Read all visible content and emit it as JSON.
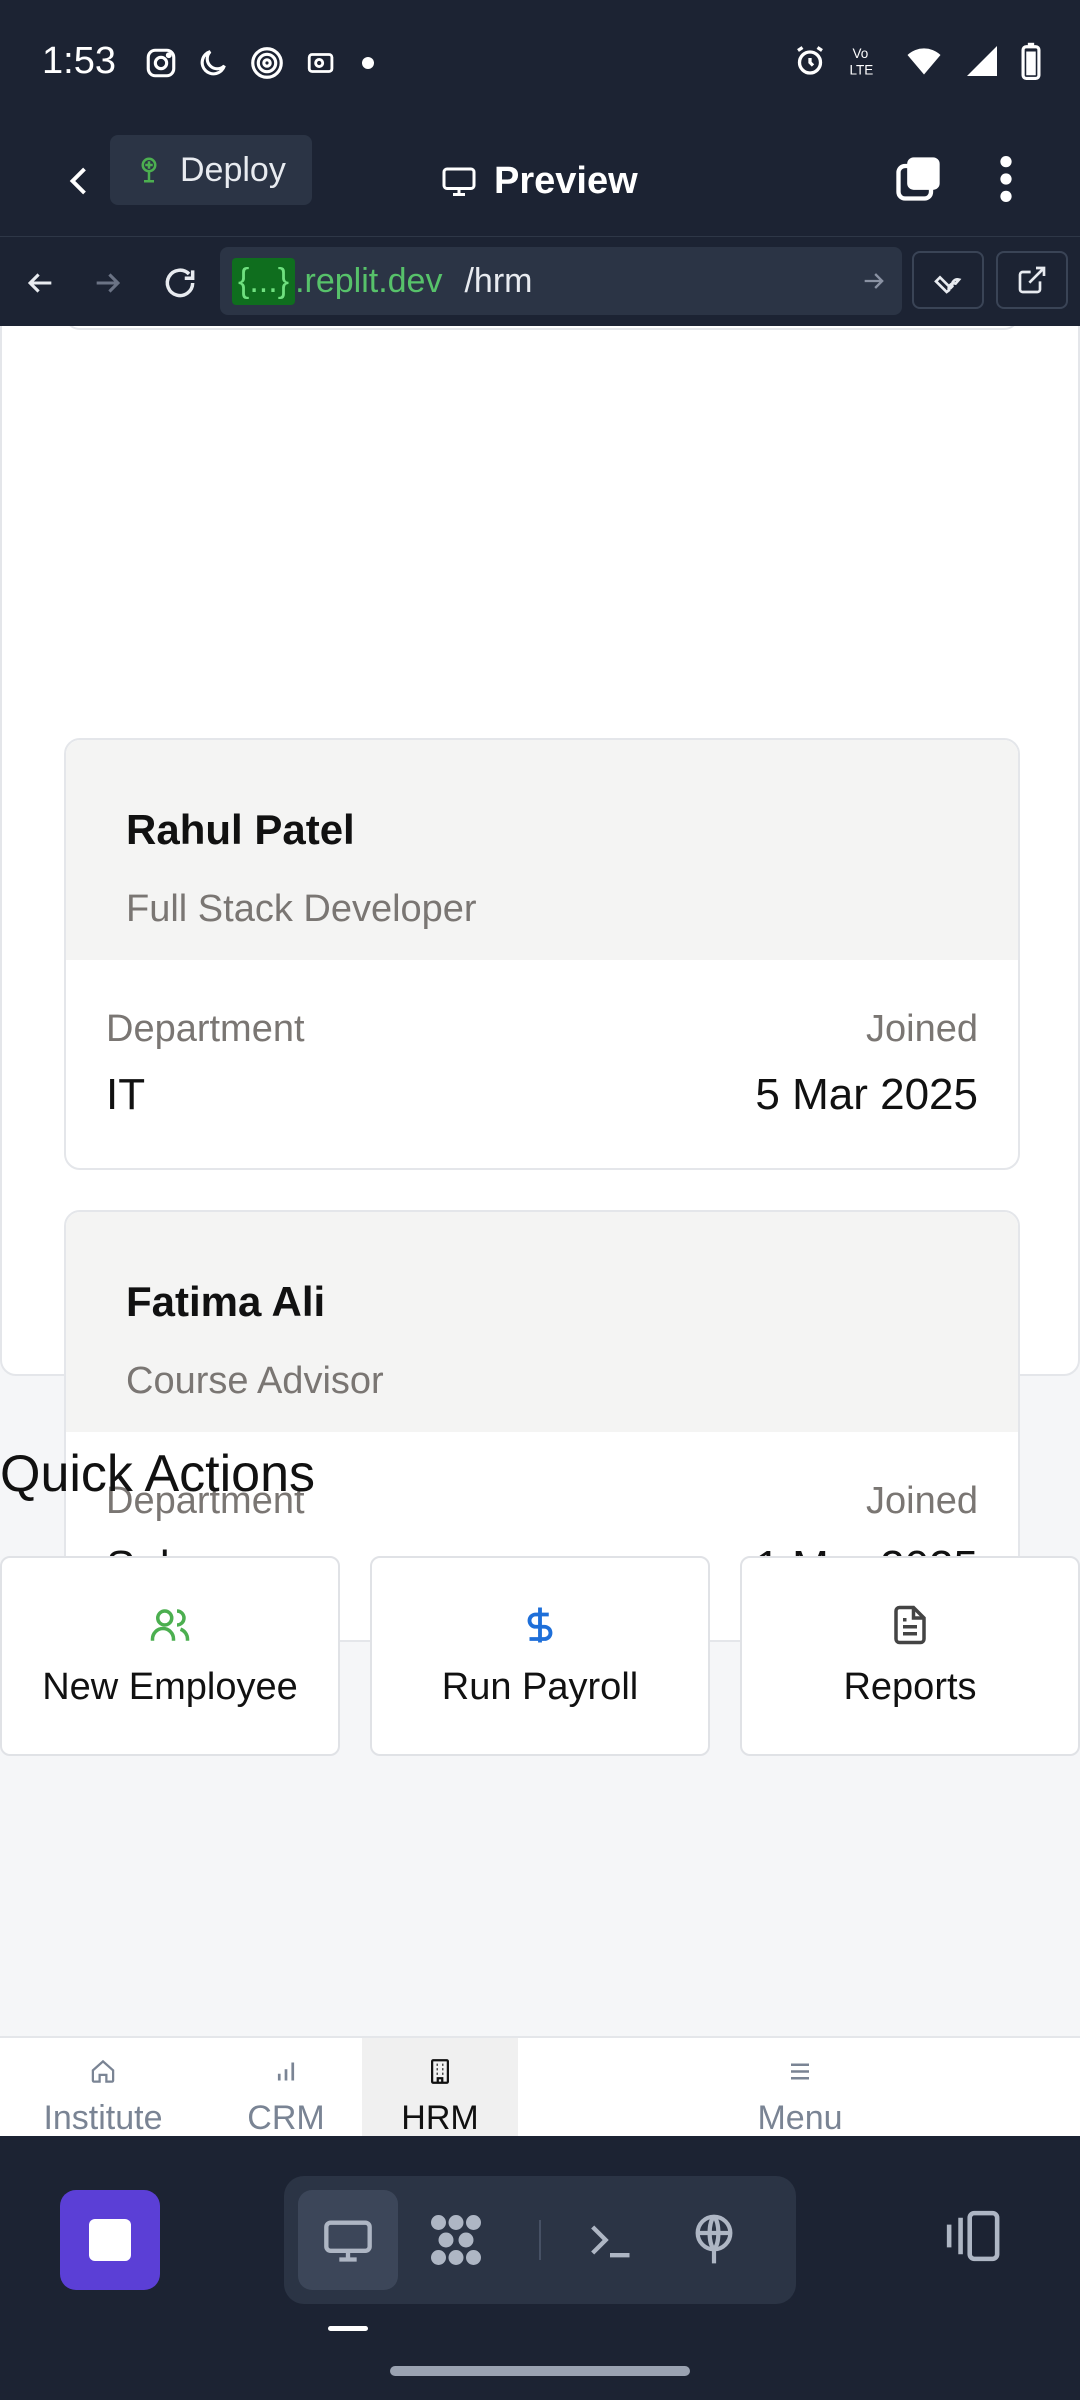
{
  "status_bar": {
    "time": "1:53",
    "left_icons": [
      "instagram-icon",
      "moon-icon",
      "signal-app-icon",
      "ticket-icon",
      "dot-icon"
    ],
    "right_icons": [
      "alarm-icon",
      "volte-icon",
      "wifi-icon",
      "cell-signal-icon",
      "battery-icon"
    ],
    "volte_text": "Vo\nLTE"
  },
  "app_bar": {
    "deploy_label": "Deploy",
    "title": "Preview"
  },
  "url_bar": {
    "host_template": "{...}",
    "host_suffix": ".replit.dev",
    "path": "/hrm"
  },
  "employees": [
    {
      "name": "Rahul Patel",
      "role": "Full Stack Developer",
      "department_label": "Department",
      "department": "IT",
      "joined_label": "Joined",
      "joined": "5 Mar 2025"
    },
    {
      "name": "Fatima Ali",
      "role": "Course Advisor",
      "department_label": "Department",
      "department": "Sales",
      "joined_label": "Joined",
      "joined": "1 Mar 2025"
    }
  ],
  "quick_actions": {
    "title": "Quick Actions",
    "items": [
      {
        "label": "New Employee",
        "icon": "users-icon",
        "color": "#4caf50"
      },
      {
        "label": "Run Payroll",
        "icon": "dollar-icon",
        "color": "#1e6fd9"
      },
      {
        "label": "Reports",
        "icon": "document-icon",
        "color": "#555555"
      }
    ]
  },
  "bottom_tabs": {
    "items": [
      {
        "label": "Institute",
        "icon": "home-icon"
      },
      {
        "label": "CRM",
        "icon": "bar-chart-icon"
      },
      {
        "label": "HRM",
        "icon": "building-icon",
        "active": true
      },
      {
        "label": "Menu",
        "icon": "hamburger-icon"
      }
    ]
  },
  "colors": {
    "dark_bg": "#1c2333",
    "accent_purple": "#5b3fd6",
    "url_green": "#57c26a"
  }
}
